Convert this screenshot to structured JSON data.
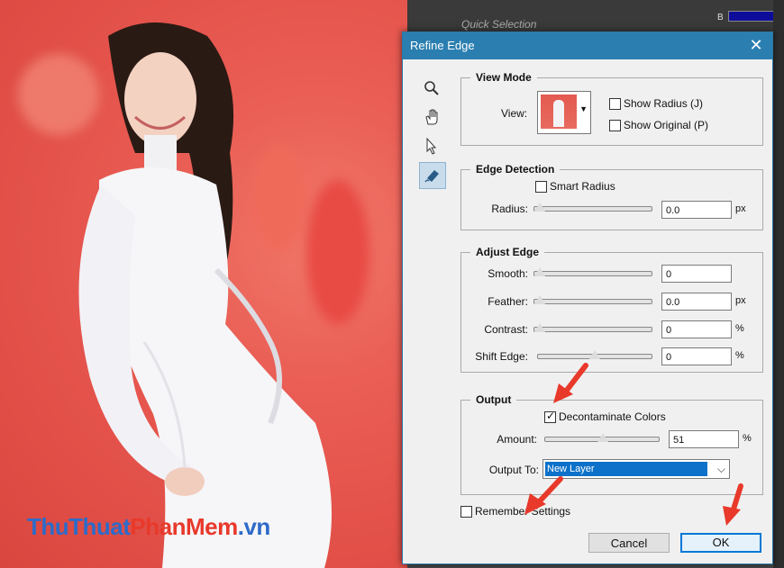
{
  "dialog": {
    "title": "Refine Edge",
    "close_glyph": "✕"
  },
  "tools": [
    "zoom-icon",
    "hand-icon",
    "pointer-icon",
    "refine-brush-icon"
  ],
  "view_mode": {
    "title": "View Mode",
    "view_label": "View:",
    "show_radius": "Show Radius (J)",
    "show_original": "Show Original (P)"
  },
  "edge_detection": {
    "title": "Edge Detection",
    "smart_radius": "Smart Radius",
    "radius_label": "Radius:",
    "radius_value": "0.0",
    "radius_unit": "px"
  },
  "adjust_edge": {
    "title": "Adjust Edge",
    "smooth_label": "Smooth:",
    "smooth_value": "0",
    "feather_label": "Feather:",
    "feather_value": "0.0",
    "feather_unit": "px",
    "contrast_label": "Contrast:",
    "contrast_value": "0",
    "contrast_unit": "%",
    "shift_label": "Shift Edge:",
    "shift_value": "0",
    "shift_unit": "%"
  },
  "output": {
    "title": "Output",
    "decontaminate": "Decontaminate Colors",
    "amount_label": "Amount:",
    "amount_value": "51",
    "amount_unit": "%",
    "output_to_label": "Output To:",
    "output_to_value": "New Layer"
  },
  "remember_settings": "Remember Settings",
  "buttons": {
    "cancel": "Cancel",
    "ok": "OK"
  },
  "background_panel": {
    "quick_selection": "Quick Selection",
    "b_label": "B"
  },
  "watermark": {
    "part1": "ThuThuat",
    "part2": "PhanMem",
    "part3": ".vn"
  },
  "colors": {
    "titlebar": "#2b7fb0",
    "arrow": "#e8392b",
    "selection": "#0d71c9"
  }
}
